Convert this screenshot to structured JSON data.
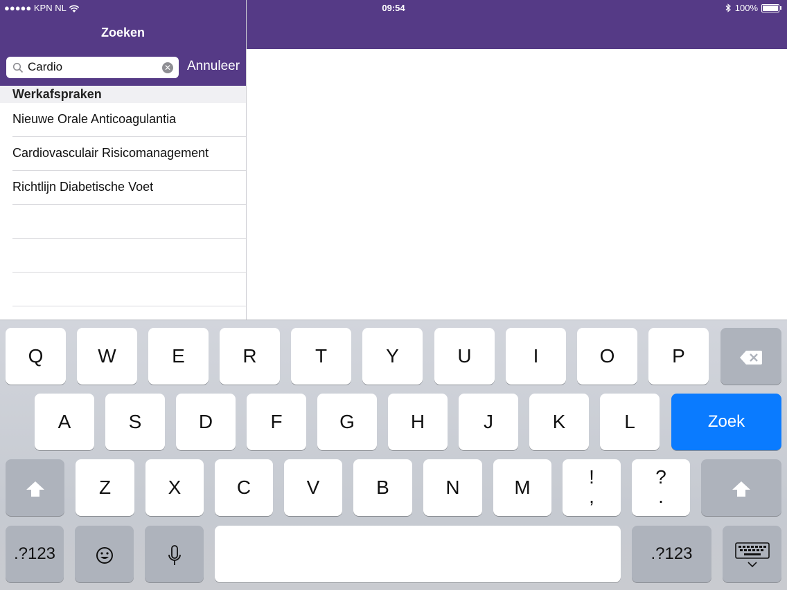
{
  "status_bar": {
    "carrier": "●●●●● KPN NL",
    "time": "09:54",
    "battery": "100%"
  },
  "header": {
    "title": "Zoeken"
  },
  "search": {
    "value": "Cardio",
    "cancel_label": "Annuleer"
  },
  "results": {
    "section_title": "Werkafspraken",
    "items": [
      {
        "label": "Nieuwe Orale Anticoagulantia"
      },
      {
        "label": "Cardiovasculair Risicomanagement"
      },
      {
        "label": "Richtlijn Diabetische Voet"
      }
    ]
  },
  "keyboard": {
    "row1": [
      "Q",
      "W",
      "E",
      "R",
      "T",
      "Y",
      "U",
      "I",
      "O",
      "P"
    ],
    "row2": [
      "A",
      "S",
      "D",
      "F",
      "G",
      "H",
      "J",
      "K",
      "L"
    ],
    "row3": [
      "Z",
      "X",
      "C",
      "V",
      "B",
      "N",
      "M"
    ],
    "punct": [
      {
        "top": "!",
        "bottom": ","
      },
      {
        "top": "?",
        "bottom": "."
      }
    ],
    "return_label": "Zoek",
    "numbers_label": ".?123",
    "return_color": "#0a7bff"
  }
}
